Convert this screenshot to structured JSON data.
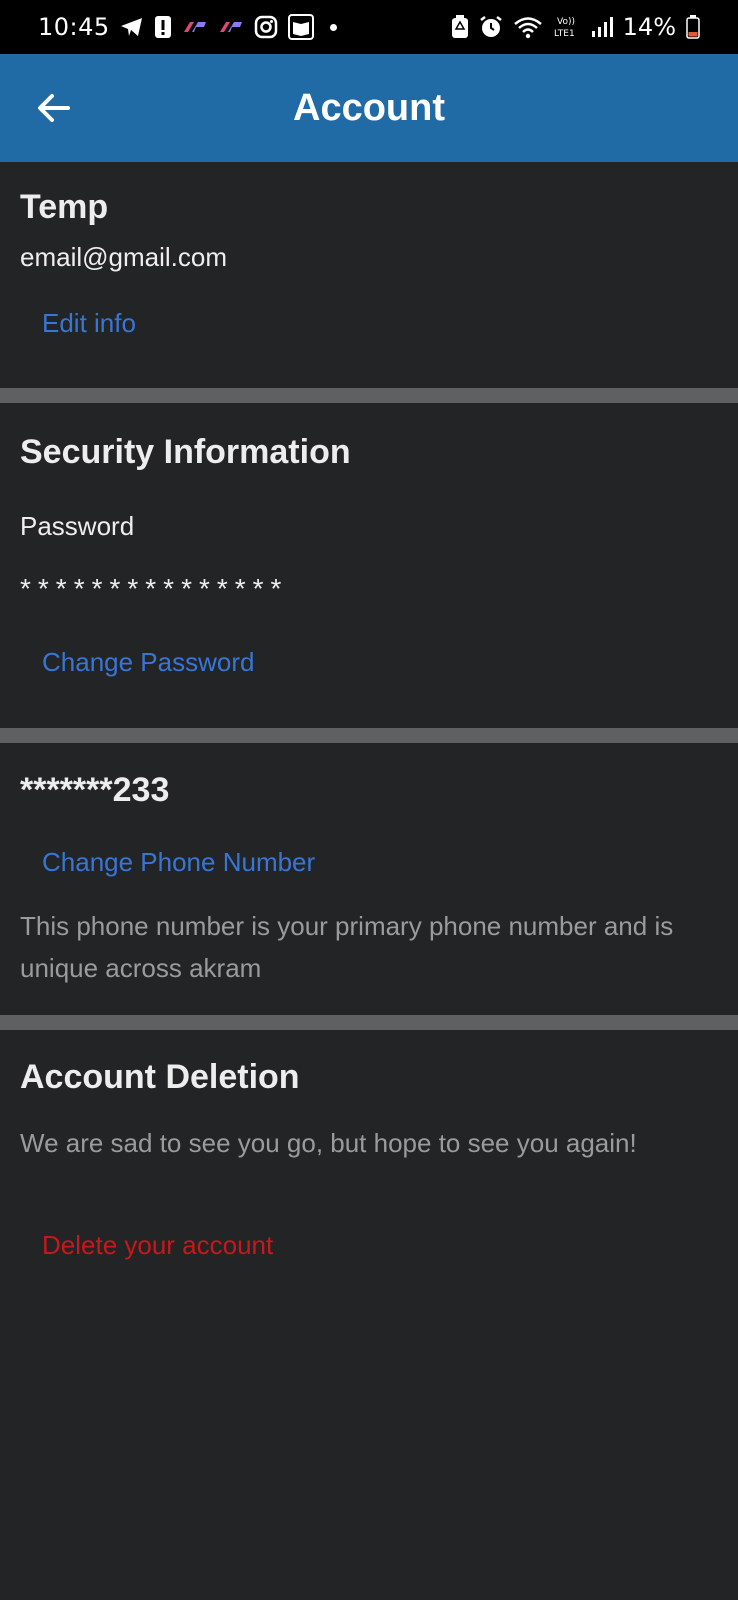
{
  "status_bar": {
    "time": "10:45",
    "battery": "14%",
    "icons_left": [
      "telegram-icon",
      "alert-icon",
      "app-icon",
      "app-icon",
      "instagram-icon",
      "book-icon"
    ],
    "icons_right": [
      "battery-saver-icon",
      "alarm-icon",
      "wifi-icon",
      "volte-icon",
      "signal-icon",
      "battery-icon"
    ]
  },
  "appbar": {
    "title": "Account"
  },
  "profile": {
    "name": "Temp",
    "email": "email@gmail.com",
    "edit_label": "Edit info"
  },
  "security": {
    "heading": "Security Information",
    "password_label": "Password",
    "password_mask": "***************",
    "change_password_label": "Change Password"
  },
  "phone": {
    "number": "*******233",
    "change_label": "Change Phone Number",
    "note": "This phone number is your primary phone number and is unique across akram"
  },
  "deletion": {
    "heading": "Account Deletion",
    "message": "We are sad to see you go, but hope to see you again!",
    "delete_label": "Delete your account"
  },
  "colors": {
    "appbar": "#206aa6",
    "link": "#3876d6",
    "danger": "#c9171a",
    "background": "#232426",
    "divider": "#5f6062"
  }
}
